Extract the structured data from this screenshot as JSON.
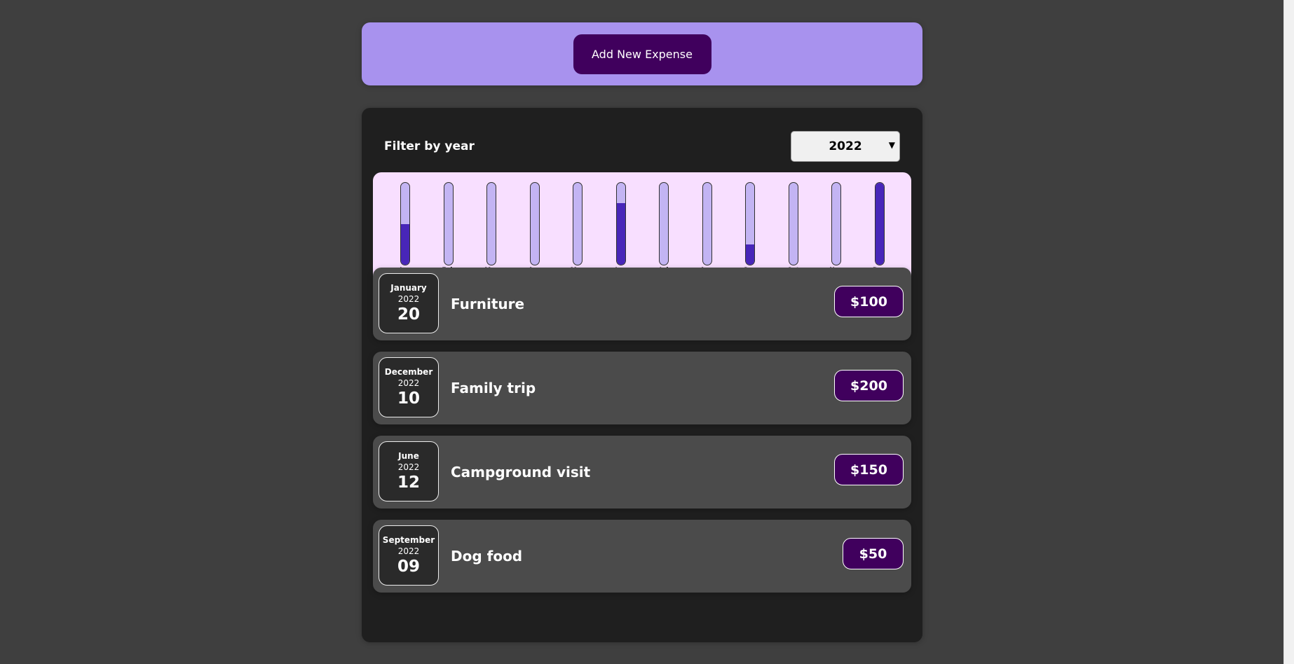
{
  "new_expense": {
    "button_label": "Add New Expense"
  },
  "filter": {
    "label": "Filter by year",
    "selected_year": "2022"
  },
  "chart_data": {
    "type": "bar",
    "categories": [
      "Jan",
      "Feb",
      "Mar",
      "Apr",
      "May",
      "Jun",
      "Jul",
      "Aug",
      "Sep",
      "Oct",
      "Nov",
      "Dec"
    ],
    "values": [
      100,
      0,
      0,
      0,
      0,
      150,
      0,
      0,
      50,
      0,
      0,
      200
    ],
    "ylim": [
      0,
      200
    ],
    "bar_color": "#4826b9",
    "track_color": "#c3b4f3"
  },
  "expenses": [
    {
      "month": "January",
      "year": "2022",
      "day": "20",
      "title": "Furniture",
      "amount": "$100"
    },
    {
      "month": "December",
      "year": "2022",
      "day": "10",
      "title": "Family trip",
      "amount": "$200"
    },
    {
      "month": "June",
      "year": "2022",
      "day": "12",
      "title": "Campground visit",
      "amount": "$150"
    },
    {
      "month": "September",
      "year": "2022",
      "day": "09",
      "title": "Dog food",
      "amount": "$50"
    }
  ],
  "colors": {
    "background": "#3f3f3f",
    "header_panel": "#a892ee",
    "accent": "#40005d",
    "chart_bg": "#f8dfff"
  }
}
